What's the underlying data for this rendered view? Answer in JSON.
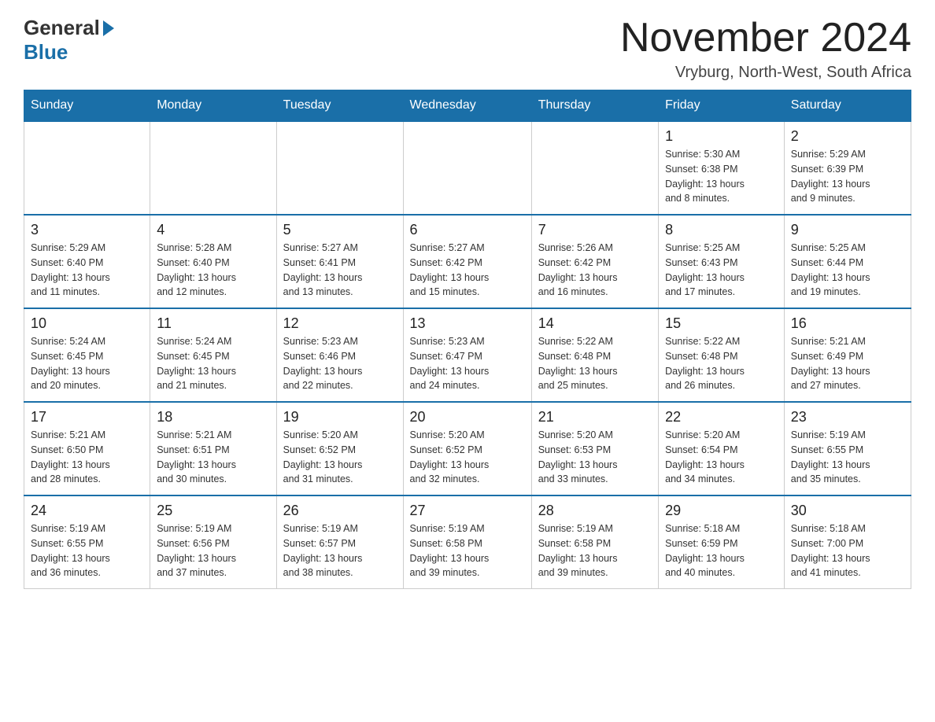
{
  "header": {
    "logo_general": "General",
    "logo_blue": "Blue",
    "title": "November 2024",
    "subtitle": "Vryburg, North-West, South Africa"
  },
  "weekdays": [
    "Sunday",
    "Monday",
    "Tuesday",
    "Wednesday",
    "Thursday",
    "Friday",
    "Saturday"
  ],
  "weeks": [
    {
      "days": [
        {
          "num": "",
          "info": ""
        },
        {
          "num": "",
          "info": ""
        },
        {
          "num": "",
          "info": ""
        },
        {
          "num": "",
          "info": ""
        },
        {
          "num": "",
          "info": ""
        },
        {
          "num": "1",
          "info": "Sunrise: 5:30 AM\nSunset: 6:38 PM\nDaylight: 13 hours\nand 8 minutes."
        },
        {
          "num": "2",
          "info": "Sunrise: 5:29 AM\nSunset: 6:39 PM\nDaylight: 13 hours\nand 9 minutes."
        }
      ]
    },
    {
      "days": [
        {
          "num": "3",
          "info": "Sunrise: 5:29 AM\nSunset: 6:40 PM\nDaylight: 13 hours\nand 11 minutes."
        },
        {
          "num": "4",
          "info": "Sunrise: 5:28 AM\nSunset: 6:40 PM\nDaylight: 13 hours\nand 12 minutes."
        },
        {
          "num": "5",
          "info": "Sunrise: 5:27 AM\nSunset: 6:41 PM\nDaylight: 13 hours\nand 13 minutes."
        },
        {
          "num": "6",
          "info": "Sunrise: 5:27 AM\nSunset: 6:42 PM\nDaylight: 13 hours\nand 15 minutes."
        },
        {
          "num": "7",
          "info": "Sunrise: 5:26 AM\nSunset: 6:42 PM\nDaylight: 13 hours\nand 16 minutes."
        },
        {
          "num": "8",
          "info": "Sunrise: 5:25 AM\nSunset: 6:43 PM\nDaylight: 13 hours\nand 17 minutes."
        },
        {
          "num": "9",
          "info": "Sunrise: 5:25 AM\nSunset: 6:44 PM\nDaylight: 13 hours\nand 19 minutes."
        }
      ]
    },
    {
      "days": [
        {
          "num": "10",
          "info": "Sunrise: 5:24 AM\nSunset: 6:45 PM\nDaylight: 13 hours\nand 20 minutes."
        },
        {
          "num": "11",
          "info": "Sunrise: 5:24 AM\nSunset: 6:45 PM\nDaylight: 13 hours\nand 21 minutes."
        },
        {
          "num": "12",
          "info": "Sunrise: 5:23 AM\nSunset: 6:46 PM\nDaylight: 13 hours\nand 22 minutes."
        },
        {
          "num": "13",
          "info": "Sunrise: 5:23 AM\nSunset: 6:47 PM\nDaylight: 13 hours\nand 24 minutes."
        },
        {
          "num": "14",
          "info": "Sunrise: 5:22 AM\nSunset: 6:48 PM\nDaylight: 13 hours\nand 25 minutes."
        },
        {
          "num": "15",
          "info": "Sunrise: 5:22 AM\nSunset: 6:48 PM\nDaylight: 13 hours\nand 26 minutes."
        },
        {
          "num": "16",
          "info": "Sunrise: 5:21 AM\nSunset: 6:49 PM\nDaylight: 13 hours\nand 27 minutes."
        }
      ]
    },
    {
      "days": [
        {
          "num": "17",
          "info": "Sunrise: 5:21 AM\nSunset: 6:50 PM\nDaylight: 13 hours\nand 28 minutes."
        },
        {
          "num": "18",
          "info": "Sunrise: 5:21 AM\nSunset: 6:51 PM\nDaylight: 13 hours\nand 30 minutes."
        },
        {
          "num": "19",
          "info": "Sunrise: 5:20 AM\nSunset: 6:52 PM\nDaylight: 13 hours\nand 31 minutes."
        },
        {
          "num": "20",
          "info": "Sunrise: 5:20 AM\nSunset: 6:52 PM\nDaylight: 13 hours\nand 32 minutes."
        },
        {
          "num": "21",
          "info": "Sunrise: 5:20 AM\nSunset: 6:53 PM\nDaylight: 13 hours\nand 33 minutes."
        },
        {
          "num": "22",
          "info": "Sunrise: 5:20 AM\nSunset: 6:54 PM\nDaylight: 13 hours\nand 34 minutes."
        },
        {
          "num": "23",
          "info": "Sunrise: 5:19 AM\nSunset: 6:55 PM\nDaylight: 13 hours\nand 35 minutes."
        }
      ]
    },
    {
      "days": [
        {
          "num": "24",
          "info": "Sunrise: 5:19 AM\nSunset: 6:55 PM\nDaylight: 13 hours\nand 36 minutes."
        },
        {
          "num": "25",
          "info": "Sunrise: 5:19 AM\nSunset: 6:56 PM\nDaylight: 13 hours\nand 37 minutes."
        },
        {
          "num": "26",
          "info": "Sunrise: 5:19 AM\nSunset: 6:57 PM\nDaylight: 13 hours\nand 38 minutes."
        },
        {
          "num": "27",
          "info": "Sunrise: 5:19 AM\nSunset: 6:58 PM\nDaylight: 13 hours\nand 39 minutes."
        },
        {
          "num": "28",
          "info": "Sunrise: 5:19 AM\nSunset: 6:58 PM\nDaylight: 13 hours\nand 39 minutes."
        },
        {
          "num": "29",
          "info": "Sunrise: 5:18 AM\nSunset: 6:59 PM\nDaylight: 13 hours\nand 40 minutes."
        },
        {
          "num": "30",
          "info": "Sunrise: 5:18 AM\nSunset: 7:00 PM\nDaylight: 13 hours\nand 41 minutes."
        }
      ]
    }
  ]
}
